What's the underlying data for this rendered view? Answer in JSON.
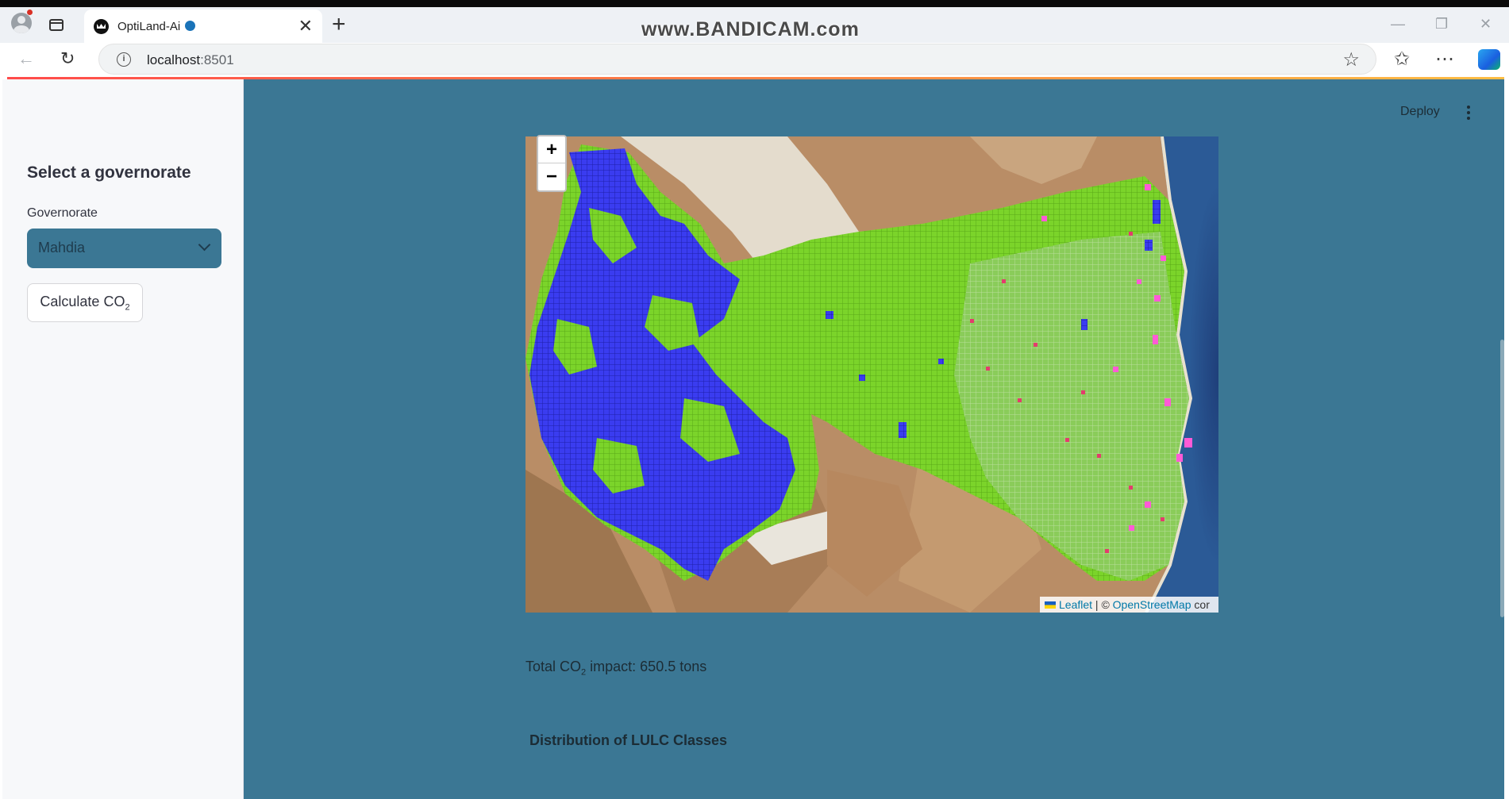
{
  "browser": {
    "tab_title": "OptiLand-Ai",
    "url_host": "localhost",
    "url_port": ":8501",
    "watermark": "www.BANDICAM.com",
    "new_tab_glyph": "+",
    "close_tab_glyph": "✕"
  },
  "sidebar": {
    "heading": "Select a governorate",
    "select_label": "Governorate",
    "select_value": "Mahdia",
    "button_label": "Calculate CO",
    "button_sub": "2"
  },
  "toolbar": {
    "deploy_label": "Deploy"
  },
  "map": {
    "zoom_in": "+",
    "zoom_out": "−",
    "attribution_leaflet": "Leaflet",
    "attribution_sep": " | © ",
    "attribution_osm": "OpenStreetMap",
    "attribution_tail": " cor",
    "legend_colors": {
      "class_a": "#3a3cf0",
      "class_b": "#7bd42a",
      "class_c": "#e33c6d",
      "class_d": "#ff5ad6"
    }
  },
  "results": {
    "total_prefix": "Total CO",
    "total_sub": "2",
    "total_suffix": " impact: 650.5 tons",
    "distribution_title": "Distribution of LULC Classes"
  },
  "colors": {
    "accent": "#3b7794",
    "progress_start": "#ff4b4b",
    "progress_end": "#ffbd45"
  }
}
